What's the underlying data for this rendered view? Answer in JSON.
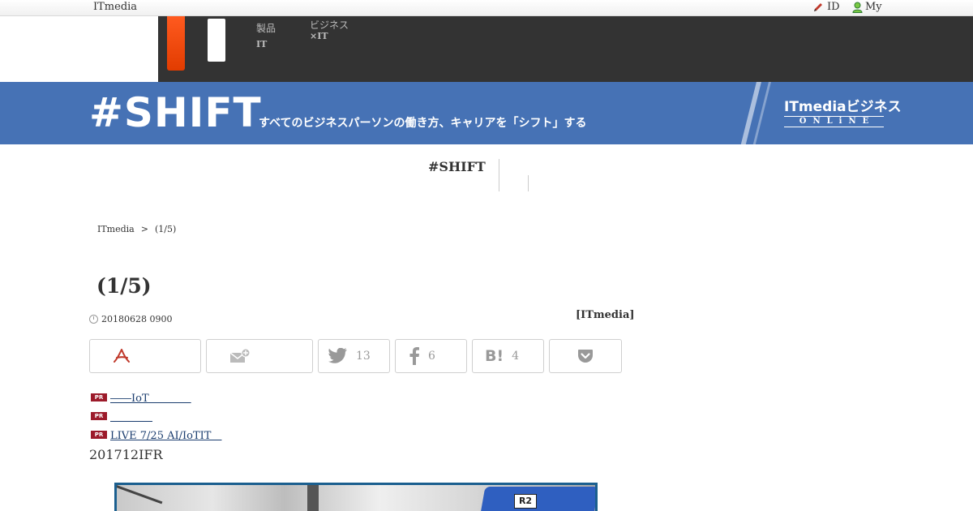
{
  "topbar": {
    "brand": "ITmedia",
    "id_label": "ID",
    "my_label": "My"
  },
  "nav": {
    "item1_line1": "製品",
    "item1_line2": "IT",
    "item2_line1": "ビジネス",
    "item2_line2": "×IT"
  },
  "banner": {
    "logo": "#SHIFT",
    "tagline": "すべてのビジネスパーソンの働き方、キャリアを「シフト」する",
    "itmedia_logo": "ITmediaビジネス",
    "online": "ONLiNE"
  },
  "subnav": {
    "title": "#SHIFT"
  },
  "breadcrumb": {
    "home": "ITmedia",
    "sep": ">",
    "current": "(1/5)"
  },
  "article": {
    "title": "(1/5)",
    "date": "20180628 0900",
    "author": "[ITmedia]",
    "body_start": "201712IFR"
  },
  "share": {
    "twitter_count": "13",
    "facebook_count": "6",
    "hatena_count": "4",
    "hatena_icon_text": "B!"
  },
  "pr_badge": "PR",
  "pr_items": [
    {
      "text": "――IoT　　　　"
    },
    {
      "text": "　　　　"
    },
    {
      "text": "LIVE 7/25 AI/IoTIT　"
    }
  ],
  "photo": {
    "label": "R2"
  },
  "colors": {
    "banner_blue": "#4672b5",
    "nav_dark": "#333333",
    "accent_orange": "#ff5a1f",
    "pr_red": "#9c1a2a",
    "link_blue": "#1a3c6e"
  }
}
